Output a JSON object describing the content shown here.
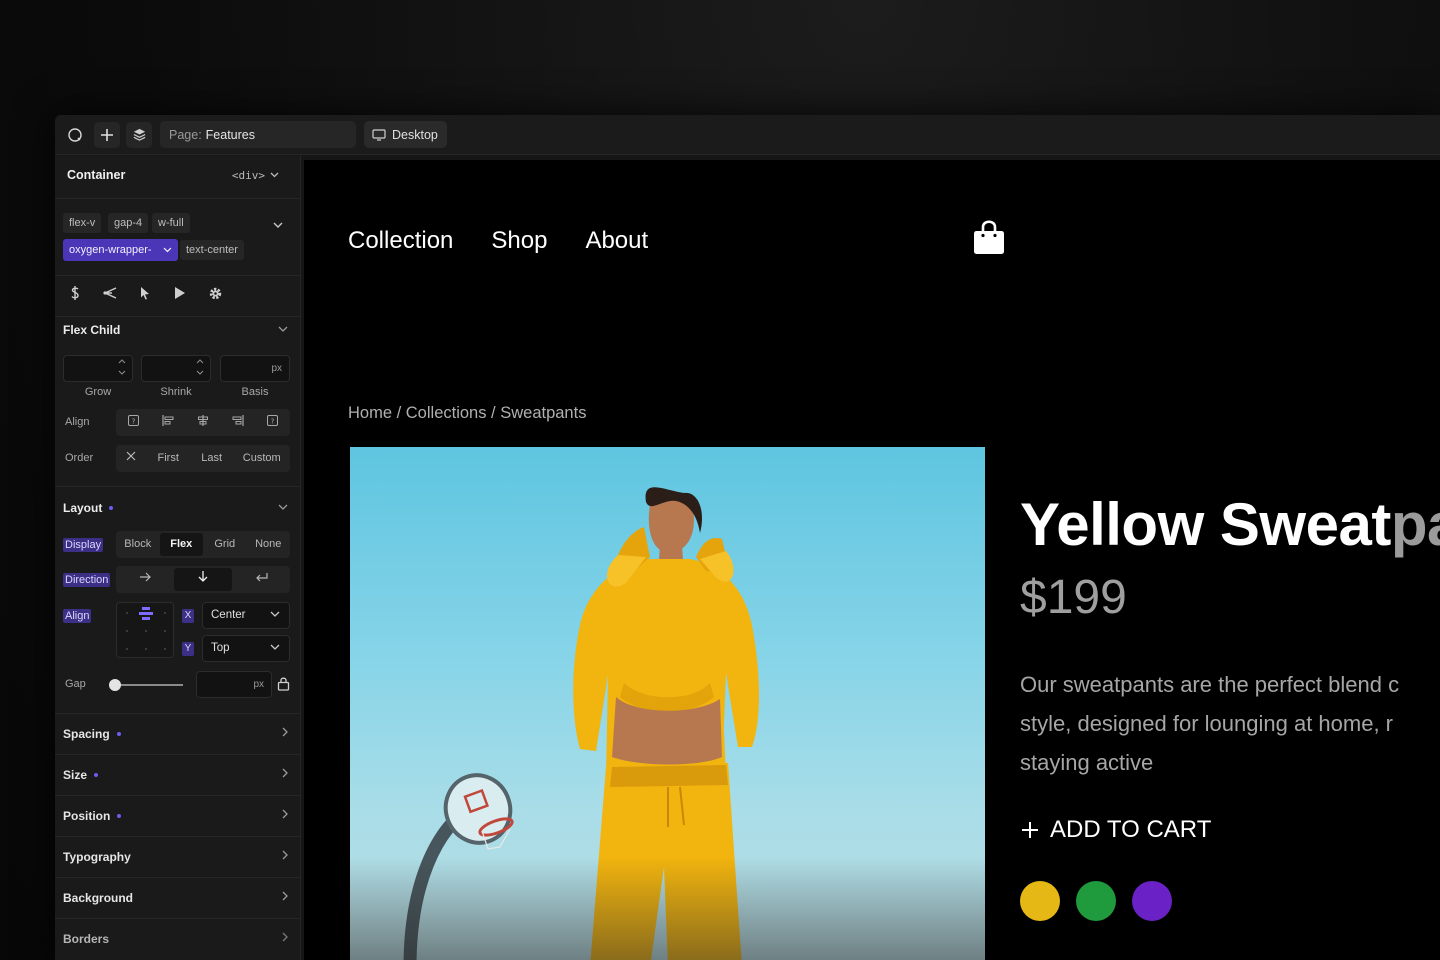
{
  "topbar": {
    "page_label": "Page:",
    "page_value": "Features",
    "device_label": "Desktop"
  },
  "sidebar": {
    "element_title": "Container",
    "element_tag": "<div>",
    "classes": [
      "flex-v",
      "gap-4",
      "w-full",
      "oxygen-wrapper-",
      "text-center"
    ],
    "flex_child": {
      "title": "Flex Child",
      "grow_label": "Grow",
      "shrink_label": "Shrink",
      "basis_label": "Basis",
      "unit": "px",
      "align_label": "Align",
      "order_label": "Order",
      "order_options": [
        "First",
        "Last",
        "Custom"
      ]
    },
    "layout": {
      "title": "Layout",
      "display_label": "Display",
      "display_options": [
        "Block",
        "Flex",
        "Grid",
        "None"
      ],
      "display_selected": "Flex",
      "direction_label": "Direction",
      "align_label": "Align",
      "x_label": "X",
      "y_label": "Y",
      "x_value": "Center",
      "y_value": "Top",
      "gap_label": "Gap",
      "gap_unit": "px",
      "gap_value": 0
    },
    "sections": [
      {
        "label": "Spacing",
        "modified": true
      },
      {
        "label": "Size",
        "modified": true
      },
      {
        "label": "Position",
        "modified": true
      },
      {
        "label": "Typography",
        "modified": false
      },
      {
        "label": "Background",
        "modified": false
      },
      {
        "label": "Borders",
        "modified": false
      }
    ],
    "accent_color": "#6b5cf0"
  },
  "canvas": {
    "nav": [
      "Collection",
      "Shop",
      "About"
    ],
    "breadcrumb": "Home / Collections / Sweatpants",
    "product_title_visible": "Yellow Sweat",
    "product_title_faded": "pa",
    "price": "$199",
    "description_lines": [
      "Our sweatpants are the perfect blend c",
      "style, designed for lounging at home, r",
      "staying active"
    ],
    "cart_label": "ADD TO CART",
    "swatches": [
      "#e5b816",
      "#1f9a3c",
      "#6a22c6"
    ]
  }
}
